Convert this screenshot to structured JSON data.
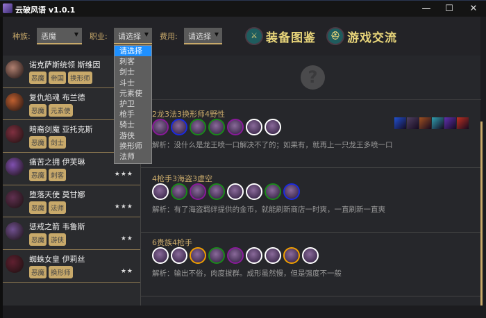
{
  "window": {
    "title": "云破风语 v1.0.1",
    "min": "—",
    "max": "☐",
    "close": "✕"
  },
  "filters": {
    "race_label": "种族:",
    "race_value": "恶魔",
    "class_label": "职业:",
    "class_value": "请选择",
    "cost_label": "费用:",
    "cost_value": "请选择",
    "class_options": [
      "请选择",
      "刺客",
      "剑士",
      "斗士",
      "元素使",
      "护卫",
      "枪手",
      "骑士",
      "游侠",
      "换形师",
      "法师"
    ]
  },
  "nav": {
    "equipment": "装备图鉴",
    "community": "游戏交流"
  },
  "heroes": [
    {
      "name": "诺克萨斯统领 斯维因",
      "tags": [
        "恶魔",
        "帝国",
        "换形师"
      ],
      "stars": "★★★"
    },
    {
      "name": "复仇焰魂 布兰德",
      "tags": [
        "恶魔",
        "元素使"
      ],
      "stars": "★★★"
    },
    {
      "name": "暗裔剑魔 亚托克斯",
      "tags": [
        "恶魔",
        "剑士"
      ],
      "stars": "★★★"
    },
    {
      "name": "痛苦之拥 伊芙琳",
      "tags": [
        "恶魔",
        "刺客"
      ],
      "stars": "★★★"
    },
    {
      "name": "堕落天使 莫甘娜",
      "tags": [
        "恶魔",
        "法师"
      ],
      "stars": "★★★"
    },
    {
      "name": "惩戒之箭 韦鲁斯",
      "tags": [
        "恶魔",
        "游侠"
      ],
      "stars": "★★"
    },
    {
      "name": "蜘蛛女皇 伊莉丝",
      "tags": [
        "恶魔",
        "换形师"
      ],
      "stars": "★★"
    }
  ],
  "placeholder": "?",
  "comps": [
    {
      "title": "2龙3法3换形师4野性",
      "desc": "解析：没什么是龙王喷一口解决不了的；如果有，就再上一只龙王多喷一口",
      "rings": [
        "#8a1a9a",
        "#1a2ae0",
        "#1a8a1a",
        "#1a8a1a",
        "#8a1a9a",
        "#ffffff",
        "#ffffff"
      ],
      "items": 6
    },
    {
      "title": "4枪手3海盗3虚空",
      "desc": "解析：有了海盗羁绊提供的金币，就能刷新商店一时爽，一直刷新一直爽",
      "rings": [
        "#ffffff",
        "#1a8a1a",
        "#8a1a9a",
        "#1a8a1a",
        "#ffffff",
        "#ffffff",
        "#1a8a1a",
        "#1a2ae0"
      ],
      "items": 0
    },
    {
      "title": "6贵族4枪手",
      "desc": "解析：输出不俗，肉度拔群。成形虽然慢，但是强度不一般",
      "rings": [
        "#ffffff",
        "#ffffff",
        "#f0a000",
        "#1a8a1a",
        "#8a1a9a",
        "#ffffff",
        "#ffffff",
        "#f0a000",
        "#ffffff"
      ],
      "items": 0
    }
  ],
  "colors": {
    "accent": "#c8a96a",
    "nav_text": "#e8d57a",
    "selected": "#1e90ff"
  }
}
